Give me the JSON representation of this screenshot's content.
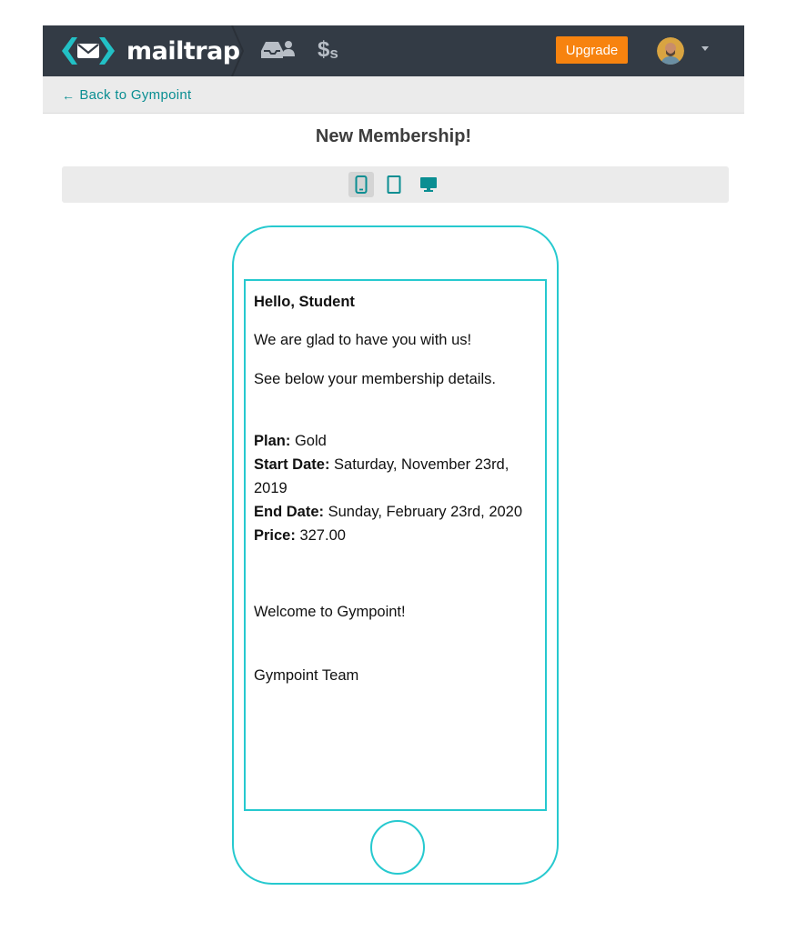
{
  "header": {
    "logo_text": "mailtrap",
    "billing_glyph_big": "$",
    "billing_glyph_small": "s",
    "upgrade_label": "Upgrade"
  },
  "subbar": {
    "back_arrow": "←",
    "back_label": "Back to Gympoint"
  },
  "page": {
    "title": "New Membership!"
  },
  "device_toggle": {
    "options": [
      "mobile",
      "tablet",
      "desktop"
    ],
    "selected": "mobile"
  },
  "email": {
    "greeting": "Hello, Student",
    "line1": "We are glad to have you with us!",
    "line2": "See below your membership details.",
    "plan_label": "Plan:",
    "plan_value": "Gold",
    "start_label": "Start Date:",
    "start_value": "Saturday, November 23rd, 2019",
    "end_label": "End Date:",
    "end_value": "Sunday, February 23rd, 2020",
    "price_label": "Price:",
    "price_value": "327.00",
    "welcome": "Welcome to Gympoint!",
    "signature": "Gympoint Team"
  },
  "colors": {
    "topbar": "#333b45",
    "accent_teal": "#26c9cf",
    "link_teal": "#0a8e92",
    "upgrade_orange": "#f7830f"
  },
  "icons": {
    "inbox": "inbox-user-icon",
    "billing": "billing-icon",
    "mobile": "mobile-icon",
    "tablet": "tablet-icon",
    "desktop": "desktop-icon"
  }
}
